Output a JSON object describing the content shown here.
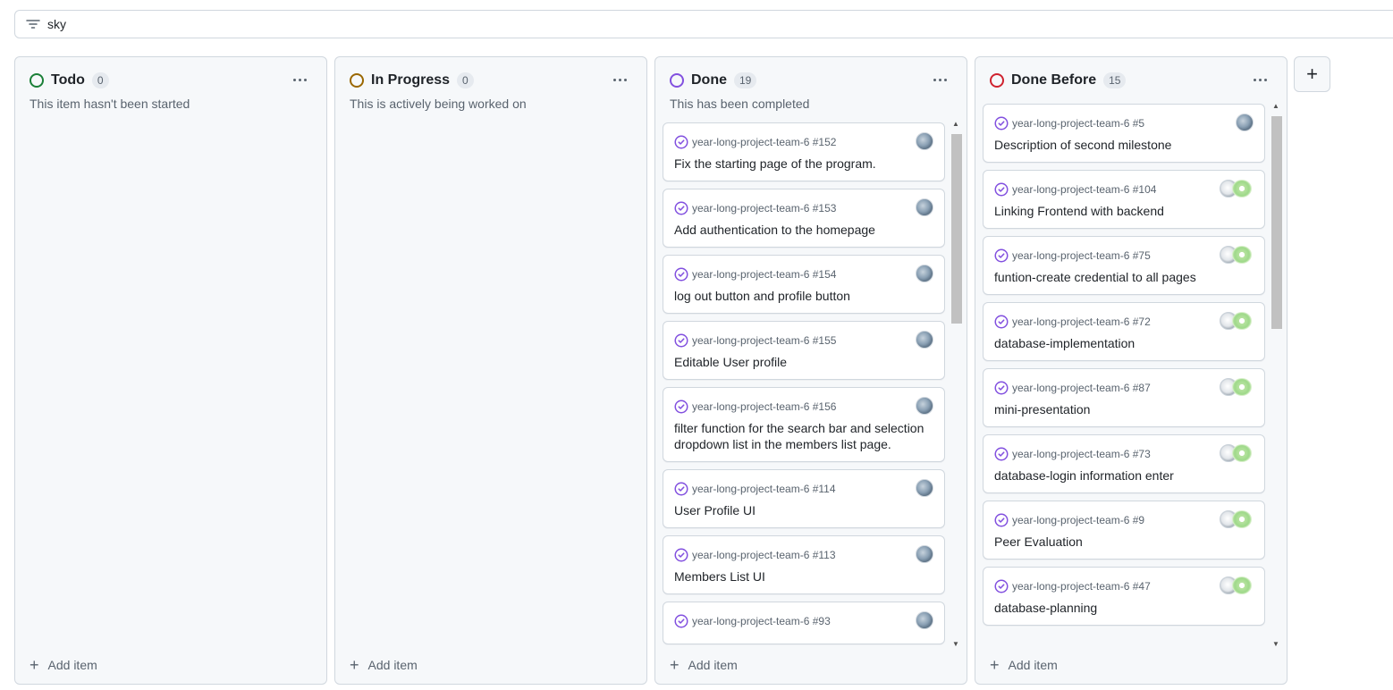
{
  "filter": {
    "value": "sky",
    "icon": "filter-icon"
  },
  "colors": {
    "todo": "#1a7f37",
    "in_progress": "#9a6700",
    "done": "#8250df",
    "done_before": "#cf222e",
    "issue_closed": "#8250df"
  },
  "columns": [
    {
      "id": "todo",
      "title": "Todo",
      "count": "0",
      "description": "This item hasn't been started",
      "add_label": "Add item",
      "cards": []
    },
    {
      "id": "in_progress",
      "title": "In Progress",
      "count": "0",
      "description": "This is actively being worked on",
      "add_label": "Add item",
      "cards": []
    },
    {
      "id": "done",
      "title": "Done",
      "count": "19",
      "description": "This has been completed",
      "add_label": "Add item",
      "cards": [
        {
          "ref": "year-long-project-team-6 #152",
          "title": "Fix the starting page of the program.",
          "assignees": "single"
        },
        {
          "ref": "year-long-project-team-6 #153",
          "title": "Add authentication to the homepage",
          "assignees": "single"
        },
        {
          "ref": "year-long-project-team-6 #154",
          "title": "log out button and profile button",
          "assignees": "single"
        },
        {
          "ref": "year-long-project-team-6 #155",
          "title": "Editable User profile",
          "assignees": "single"
        },
        {
          "ref": "year-long-project-team-6 #156",
          "title": "filter function for the search bar and selection dropdown list in the members list page.",
          "assignees": "single"
        },
        {
          "ref": "year-long-project-team-6 #114",
          "title": "User Profile UI",
          "assignees": "single"
        },
        {
          "ref": "year-long-project-team-6 #113",
          "title": "Members List UI",
          "assignees": "single"
        },
        {
          "ref": "year-long-project-team-6 #93",
          "title": "",
          "assignees": "single"
        }
      ]
    },
    {
      "id": "done_before",
      "title": "Done Before",
      "count": "15",
      "description": "",
      "add_label": "Add item",
      "cards": [
        {
          "ref": "year-long-project-team-6 #5",
          "title": "Description of second milestone",
          "assignees": "single"
        },
        {
          "ref": "year-long-project-team-6 #104",
          "title": "Linking Frontend with backend",
          "assignees": "group"
        },
        {
          "ref": "year-long-project-team-6 #75",
          "title": "funtion-create credential to all pages",
          "assignees": "group"
        },
        {
          "ref": "year-long-project-team-6 #72",
          "title": "database-implementation",
          "assignees": "group"
        },
        {
          "ref": "year-long-project-team-6 #87",
          "title": "mini-presentation",
          "assignees": "group"
        },
        {
          "ref": "year-long-project-team-6 #73",
          "title": "database-login information enter",
          "assignees": "group"
        },
        {
          "ref": "year-long-project-team-6 #9",
          "title": "Peer Evaluation",
          "assignees": "group"
        },
        {
          "ref": "year-long-project-team-6 #47",
          "title": "database-planning",
          "assignees": "group"
        }
      ]
    }
  ],
  "add_column": {
    "label": "+"
  }
}
